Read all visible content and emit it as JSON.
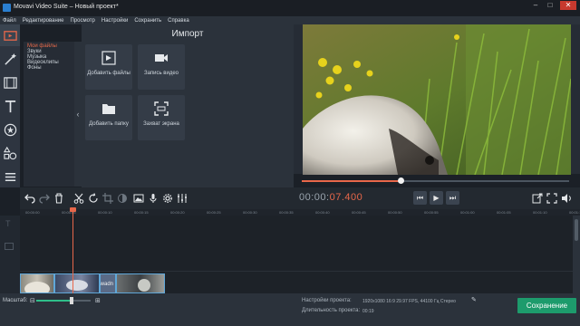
{
  "window": {
    "title": "Movavi Video Suite – Новый проект*"
  },
  "menu": [
    "Файл",
    "Редактирование",
    "Просмотр",
    "Настройки",
    "Сохранить",
    "Справка"
  ],
  "categories": [
    {
      "label": "Мои файлы",
      "selected": true
    },
    {
      "label": "Звуки"
    },
    {
      "label": "Музыка"
    },
    {
      "label": "Видеоклипы"
    },
    {
      "label": "Фоны"
    }
  ],
  "import": {
    "title": "Импорт",
    "tiles": [
      {
        "label": "Добавить файлы",
        "icon": "add-files-icon"
      },
      {
        "label": "Запись видео",
        "icon": "video-camera-icon"
      },
      {
        "label": "Добавить папку",
        "icon": "folder-icon"
      },
      {
        "label": "Захват экрана",
        "icon": "screen-capture-icon"
      }
    ]
  },
  "player": {
    "timecode_prefix": "00:00:",
    "timecode_active": "07.400",
    "progress": 0.37,
    "accent": "#e8674a"
  },
  "timeline": {
    "ticks": [
      "00:00:00",
      "00:00:05",
      "00:00:10",
      "00:00:15",
      "00:00:20",
      "00:00:25",
      "00:00:30",
      "00:00:35",
      "00:00:40",
      "00:00:45",
      "00:00:50",
      "00:00:55",
      "00:01:00",
      "00:01:05",
      "00:01:10",
      "00:01:15"
    ],
    "clip_label": "wadn"
  },
  "bottom": {
    "zoom_label": "Масштаб:",
    "zoom_level": 0.65,
    "project_settings_label": "Настройки проекта:",
    "project_settings_value": "1920x1080 16:9 29.97 FPS, 44100 Гц Стерео",
    "duration_label": "Длительность проекта:",
    "duration_value": "00:19",
    "save_label": "Сохранение",
    "save_color": "#1d9b6c"
  }
}
